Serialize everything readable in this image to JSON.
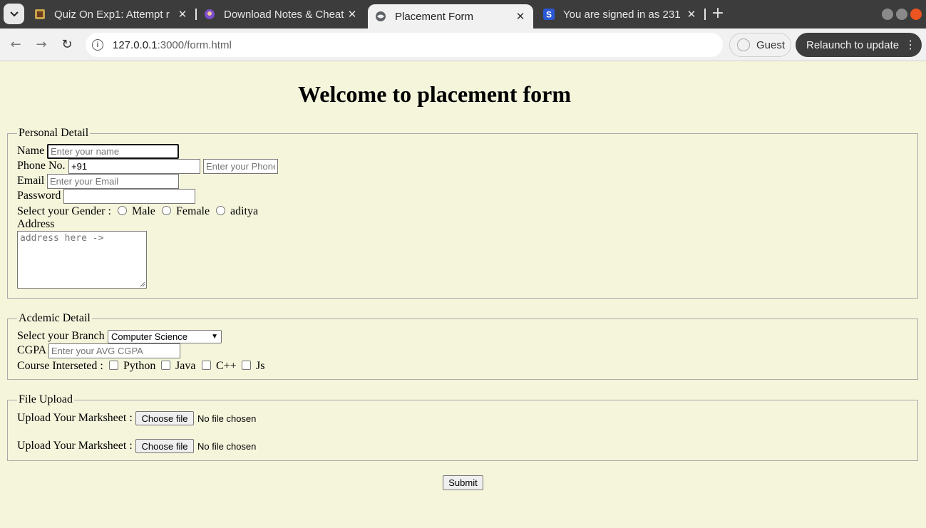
{
  "browser": {
    "tabs": [
      {
        "title": "Quiz On Exp1: Attempt r",
        "active": false
      },
      {
        "title": "Download Notes & Cheat",
        "active": false
      },
      {
        "title": "Placement Form",
        "active": true
      },
      {
        "title": "You are signed in as 231",
        "active": false
      }
    ],
    "url_host": "127.0.0.1",
    "url_path": ":3000/form.html",
    "profile_label": "Guest",
    "relaunch_label": "Relaunch to update",
    "new_tab_symbol": "+"
  },
  "page": {
    "title": "Welcome to placement form",
    "personal": {
      "legend": "Personal Detail",
      "name_label": "Name",
      "name_placeholder": "Enter your name",
      "phone_label": "Phone No.",
      "phone_code_value": "+91",
      "phone_placeholder": "Enter your Phone",
      "email_label": "Email",
      "email_placeholder": "Enter your Email",
      "password_label": "Password",
      "gender_label": "Select your Gender :",
      "gender_options": [
        "Male",
        "Female",
        "aditya"
      ],
      "address_label": "Address",
      "address_placeholder": "address here ->"
    },
    "academic": {
      "legend": "Acdemic Detail",
      "branch_label": "Select your Branch",
      "branch_value": "Computer Science",
      "cgpa_label": "CGPA",
      "cgpa_placeholder": "Enter your AVG CGPA",
      "course_label": "Course Interseted :",
      "course_options": [
        "Python",
        "Java",
        "C++",
        "Js"
      ]
    },
    "upload": {
      "legend": "File Upload",
      "rows": [
        {
          "label": "Upload Your Marksheet :",
          "button": "Choose file",
          "status": "No file chosen"
        },
        {
          "label": "Upload Your Marksheet :",
          "button": "Choose file",
          "status": "No file chosen"
        }
      ]
    },
    "submit_label": "Submit"
  }
}
